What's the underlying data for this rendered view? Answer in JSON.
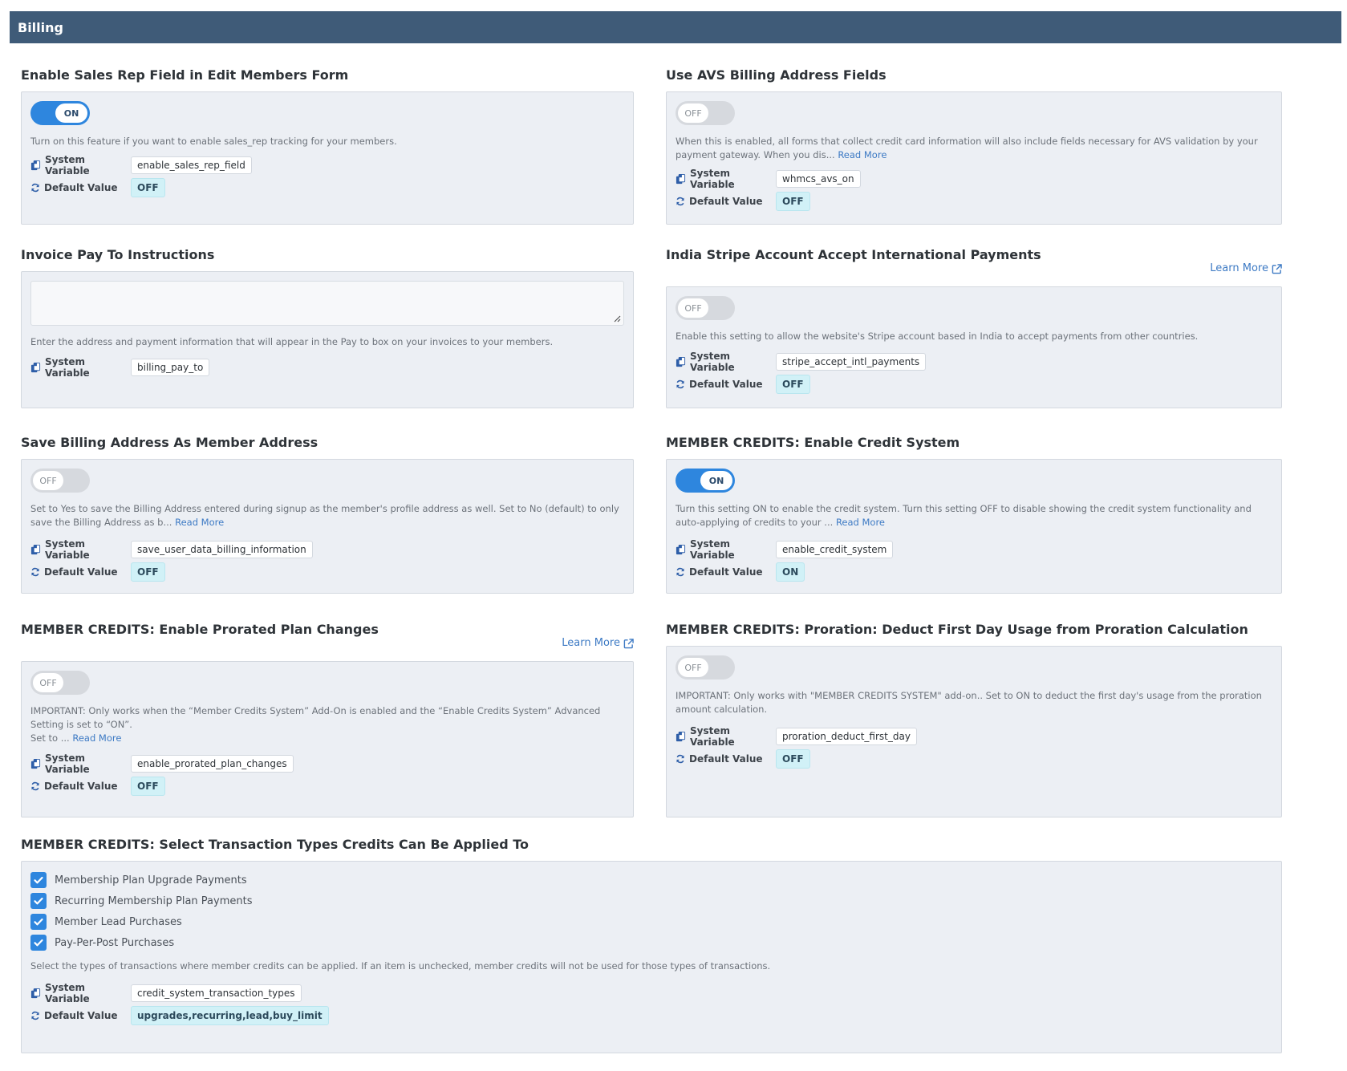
{
  "header": {
    "title": "Billing"
  },
  "labels": {
    "system_variable": "System Variable",
    "default_value": "Default Value",
    "read_more": "Read More",
    "learn_more": "Learn More"
  },
  "settings": {
    "sales_rep": {
      "title": "Enable Sales Rep Field in Edit Members Form",
      "toggle": "ON",
      "description": "Turn on this feature if you want to enable sales_rep tracking for your members.",
      "variable": "enable_sales_rep_field",
      "default": "OFF"
    },
    "avs": {
      "title": "Use AVS Billing Address Fields",
      "toggle": "OFF",
      "description": "When this is enabled, all forms that collect credit card information will also include fields necessary for AVS validation by your payment gateway. When you dis...",
      "variable": "whmcs_avs_on",
      "default": "OFF"
    },
    "pay_to": {
      "title": "Invoice Pay To Instructions",
      "textarea_value": "",
      "description": "Enter the address and payment information that will appear in the Pay to box on your invoices to your members.",
      "variable": "billing_pay_to"
    },
    "india_stripe": {
      "title": "India Stripe Account Accept International Payments",
      "toggle": "OFF",
      "description": "Enable this setting to allow the website's Stripe account based in India to accept payments from other countries.",
      "variable": "stripe_accept_intl_payments",
      "default": "OFF"
    },
    "save_billing": {
      "title": "Save Billing Address As Member Address",
      "toggle": "OFF",
      "description": "Set to Yes to save the Billing Address entered during signup as the member's profile address as well.  Set to No (default) to only save the Billing Address as b...",
      "variable": "save_user_data_billing_information",
      "default": "OFF"
    },
    "credit_system": {
      "title": "MEMBER CREDITS: Enable Credit System",
      "toggle": "ON",
      "description": "Turn this setting ON to enable the credit system. Turn this setting OFF to disable showing the credit system functionality and auto-applying of credits to your ...",
      "variable": "enable_credit_system",
      "default": "ON"
    },
    "prorated": {
      "title": "MEMBER CREDITS: Enable Prorated Plan Changes",
      "toggle": "OFF",
      "description_line1": "IMPORTANT: Only works when the “Member Credits System” Add-On is enabled and the “Enable Credits System” Advanced Setting is set to “ON”.",
      "description_line2": "Set to ...",
      "variable": "enable_prorated_plan_changes",
      "default": "OFF"
    },
    "proration_first_day": {
      "title": "MEMBER CREDITS: Proration: Deduct First Day Usage from Proration Calculation",
      "toggle": "OFF",
      "description": "IMPORTANT: Only works with \"MEMBER CREDITS SYSTEM\" add-on.. Set to ON to deduct the first day's usage from the proration amount calculation.",
      "variable": "proration_deduct_first_day",
      "default": "OFF"
    },
    "transaction_types": {
      "title": "MEMBER CREDITS: Select Transaction Types Credits Can Be Applied To",
      "options": [
        "Membership Plan Upgrade Payments",
        "Recurring Membership Plan Payments",
        "Member Lead Purchases",
        "Pay-Per-Post Purchases"
      ],
      "description": "Select the types of transactions where member credits can be applied. If an item is unchecked, member credits will not be used for those types of transactions.",
      "variable": "credit_system_transaction_types",
      "default": "upgrades,recurring,lead,buy_limit"
    }
  },
  "colors": {
    "header": "#3f5b78",
    "accent": "#2e86de",
    "panel": "#eceff4",
    "default_chip": "#d1f1f7"
  }
}
